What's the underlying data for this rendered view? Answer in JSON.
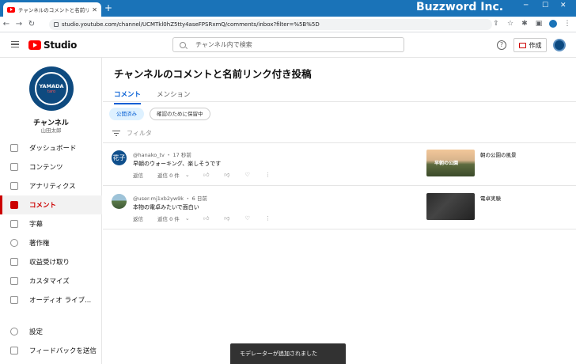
{
  "browser": {
    "tab_title": "チャンネルのコメントと名前リンク付き投",
    "new_tab": "+",
    "brand": "Buzzword Inc.",
    "url": "studio.youtube.com/channel/UCMTkl0hZ5tty4aseFPSRxmQ/comments/inbox?filter=%5B%5D"
  },
  "header": {
    "logo_text": "Studio",
    "search_placeholder": "チャンネル内で検索",
    "create_label": "作成"
  },
  "sidebar": {
    "avatar_text": "YAMADA",
    "avatar_sub": "taro",
    "channel_name": "チャンネル",
    "user_name": "山田太郎",
    "items": [
      {
        "label": "ダッシュボード",
        "active": false
      },
      {
        "label": "コンテンツ",
        "active": false
      },
      {
        "label": "アナリティクス",
        "active": false
      },
      {
        "label": "コメント",
        "active": true
      },
      {
        "label": "字幕",
        "active": false
      },
      {
        "label": "著作権",
        "active": false
      },
      {
        "label": "収益受け取り",
        "active": false
      },
      {
        "label": "カスタマイズ",
        "active": false
      },
      {
        "label": "オーディオ ライブ...",
        "active": false
      }
    ],
    "bottom_items": [
      {
        "label": "設定"
      },
      {
        "label": "フィードバックを送信"
      }
    ]
  },
  "main": {
    "title": "チャンネルのコメントと名前リンク付き投稿",
    "tabs": [
      {
        "label": "コメント",
        "active": true
      },
      {
        "label": "メンション",
        "active": false
      }
    ],
    "chips": [
      {
        "label": "公開済み",
        "active": true
      },
      {
        "label": "確認のために保留中",
        "active": false
      }
    ],
    "filter_label": "フィルタ",
    "comments": [
      {
        "avatar_text": "花子",
        "meta": "@hanako_tv ・ 17 秒前",
        "text": "早朝のウォーキング、楽しそうです",
        "reply_label": "返信",
        "replies_label": "返信 0 件",
        "video_title": "朝の公園の風景",
        "thumb_caption": "早朝の公園"
      },
      {
        "avatar_text": "",
        "meta": "@user-mj1xb2yw9k ・ 6 日前",
        "text": "本物の電卓みたいで面白い",
        "reply_label": "返信",
        "replies_label": "返信 0 件",
        "video_title": "電卓実験",
        "thumb_caption": ""
      }
    ]
  },
  "toast": "モデレーターが追加されました"
}
